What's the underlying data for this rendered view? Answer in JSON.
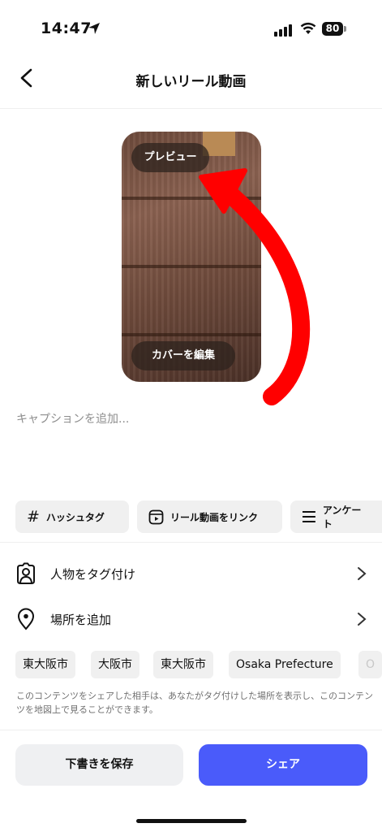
{
  "status": {
    "time": "14:47",
    "battery": "80"
  },
  "header": {
    "title": "新しいリール動画"
  },
  "preview": {
    "label": "プレビュー",
    "cover_button": "カバーを編集"
  },
  "caption": {
    "placeholder": "キャプションを追加..."
  },
  "chips": [
    {
      "label": "ハッシュタグ",
      "icon": "hash-icon"
    },
    {
      "label": "リール動画をリンク",
      "icon": "reel-icon"
    },
    {
      "label": "アンケート",
      "icon": "list-icon"
    }
  ],
  "rows": {
    "tag_people": "人物をタグ付け",
    "add_location": "場所を追加"
  },
  "locations": [
    "東大阪市",
    "大阪市",
    "東大阪市",
    "Osaka Prefecture",
    "O"
  ],
  "location_note": "このコンテンツをシェアした相手は、あなたがタグ付けした場所を表示し、このコンテンツを地図上で見ることができます。",
  "footer": {
    "draft": "下書きを保存",
    "share": "シェア"
  },
  "colors": {
    "share": "#4a5bfa",
    "annotation_arrow": "#ff0000"
  }
}
